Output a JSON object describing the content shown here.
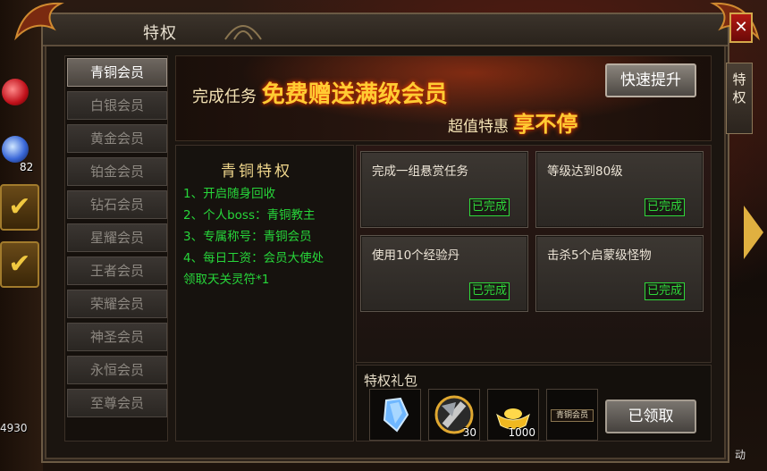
{
  "window": {
    "title": "特权",
    "close_label": "✕"
  },
  "side_tab": {
    "label": "特\n权"
  },
  "hud": {
    "count": "82",
    "bottom_number": "4930",
    "right_text": "动"
  },
  "menu": {
    "items": [
      {
        "label": "青铜会员",
        "active": true
      },
      {
        "label": "白银会员",
        "active": false
      },
      {
        "label": "黄金会员",
        "active": false
      },
      {
        "label": "铂金会员",
        "active": false
      },
      {
        "label": "钻石会员",
        "active": false
      },
      {
        "label": "星耀会员",
        "active": false
      },
      {
        "label": "王者会员",
        "active": false
      },
      {
        "label": "荣耀会员",
        "active": false
      },
      {
        "label": "神圣会员",
        "active": false
      },
      {
        "label": "永恒会员",
        "active": false
      },
      {
        "label": "至尊会员",
        "active": false
      }
    ]
  },
  "banner": {
    "line1_prefix": "完成任务",
    "line1_highlight": "免费赠送满级会员",
    "line2_prefix": "超值特惠",
    "line2_highlight": "享不停",
    "quick_button": "快速提升"
  },
  "privilege": {
    "title": "青铜特权",
    "lines": [
      "1、开启随身回收",
      "2、个人boss：青铜教主",
      "3、专属称号：青铜会员",
      "4、每日工资：会员大使处",
      "领取天关灵符*1"
    ]
  },
  "tasks": [
    {
      "name": "完成一组悬赏任务",
      "status": "已完成"
    },
    {
      "name": "等级达到80级",
      "status": "已完成"
    },
    {
      "name": "使用10个经验丹",
      "status": "已完成"
    },
    {
      "name": "击杀5个启蒙级怪物",
      "status": "已完成"
    }
  ],
  "gift": {
    "title": "特权礼包",
    "items": [
      {
        "icon": "blue-crystal-icon",
        "qty": ""
      },
      {
        "icon": "axe-icon",
        "qty": "30"
      },
      {
        "icon": "gold-ingot-icon",
        "qty": "1000"
      },
      {
        "icon": "title-badge-icon",
        "qty": "",
        "badge_text": "青铜会员"
      }
    ],
    "claim_button": "已领取"
  },
  "colors": {
    "task_done": "#2fd83a",
    "privilege_text": "#27d63a",
    "accent_gold": "#ffcc33"
  }
}
